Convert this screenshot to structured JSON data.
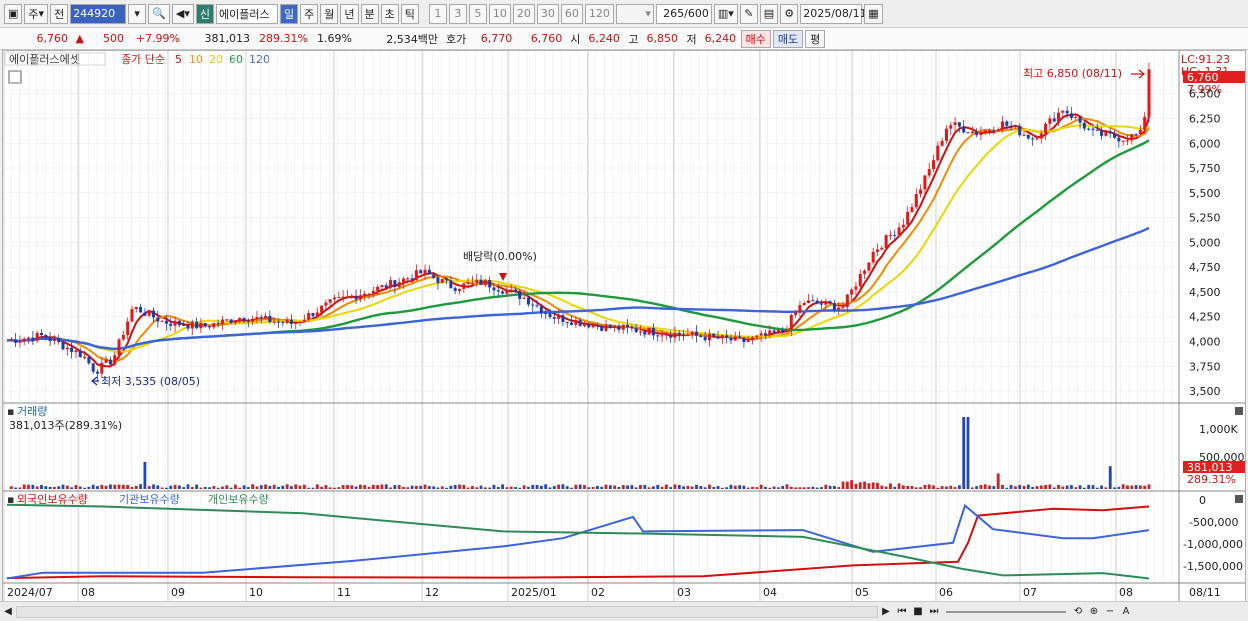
{
  "toolbar": {
    "market": "주",
    "prev_label": "전",
    "code": "244920",
    "new_badge": "신",
    "stock_name": "에이플러스",
    "periods": [
      "일",
      "주",
      "월",
      "년",
      "분",
      "초",
      "틱"
    ],
    "intervals": [
      "1",
      "3",
      "5",
      "10",
      "20",
      "30",
      "60",
      "120"
    ],
    "count": "265",
    "count_total": "/600",
    "date": "2025/08/11"
  },
  "quote": {
    "price": "6,760",
    "change": "500",
    "change_pct": "+7.99%",
    "volume": "381,013",
    "volume_ratio": "289.31%",
    "turnover_pct": "1.69%",
    "amount": "2,534백만",
    "hoga_label": "호가",
    "ask": "6,770",
    "bid": "6,760",
    "open_label": "시",
    "open": "6,240",
    "high_label": "고",
    "high": "6,850",
    "low_label": "저",
    "low": "6,240",
    "buy_label": "매수",
    "sell_label": "매도",
    "eval_label": "평"
  },
  "main_legend": {
    "name": "에이플러스에셋",
    "ma_label": "종가 단순",
    "ma_periods": [
      "5",
      "10",
      "20",
      "60",
      "120"
    ],
    "ma_colors": [
      "#d01010",
      "#f08c00",
      "#e8d800",
      "#1e9a3c",
      "#3c64d8"
    ]
  },
  "annotations": {
    "lc": "LC:91.23",
    "hc": "HC:-1.31",
    "high_note": "최고 6,850 (08/11)",
    "low_note": "최저 3,535 (08/05)",
    "dividend_note": "배당락(0.00%)",
    "last_price_tag": "6,760",
    "last_pct_tag": "7.99%"
  },
  "price_axis": [
    "6,500",
    "6,250",
    "6,000",
    "5,750",
    "5,500",
    "5,250",
    "5,000",
    "4,750",
    "4,500",
    "4,250",
    "4,000",
    "3,750",
    "3,500"
  ],
  "volume_panel": {
    "title": "거래량",
    "value": "381,013주(289.31%)",
    "axis": [
      "1,000K",
      "500,000"
    ],
    "tag_value": "381,013",
    "tag_pct": "289.31%"
  },
  "holdings_panel": {
    "series_names": [
      "외국인보유수량",
      "기관보유수량",
      "개인보유수량"
    ],
    "colors": [
      "#d01010",
      "#3c64d8",
      "#2e8b57"
    ],
    "axis": [
      "0",
      "-500,000",
      "-1,000,000",
      "-1,500,000"
    ]
  },
  "date_axis": [
    "2024/07",
    "08",
    "09",
    "10",
    "11",
    "12",
    "2025/01",
    "02",
    "03",
    "04",
    "05",
    "06",
    "07",
    "08"
  ],
  "date_tag": "08/11",
  "chart_data": {
    "type": "line",
    "title": "",
    "x_range": [
      "2024/07",
      "2025/08/11"
    ],
    "ylim": [
      3400,
      6850
    ],
    "series": [
      {
        "name": "에이플러스에셋",
        "x": [
          "2024/07",
          "2024/08",
          "2024/09",
          "2024/10",
          "2024/11",
          "2024/12",
          "2025/01",
          "2025/02",
          "2025/03",
          "2025/04",
          "2025/05",
          "2025/06",
          "2025/07",
          "2025/08"
        ],
        "values": [
          4000,
          3800,
          4250,
          4200,
          4400,
          4650,
          4500,
          4200,
          4100,
          4050,
          4600,
          6200,
          6300,
          6760
        ]
      }
    ]
  }
}
